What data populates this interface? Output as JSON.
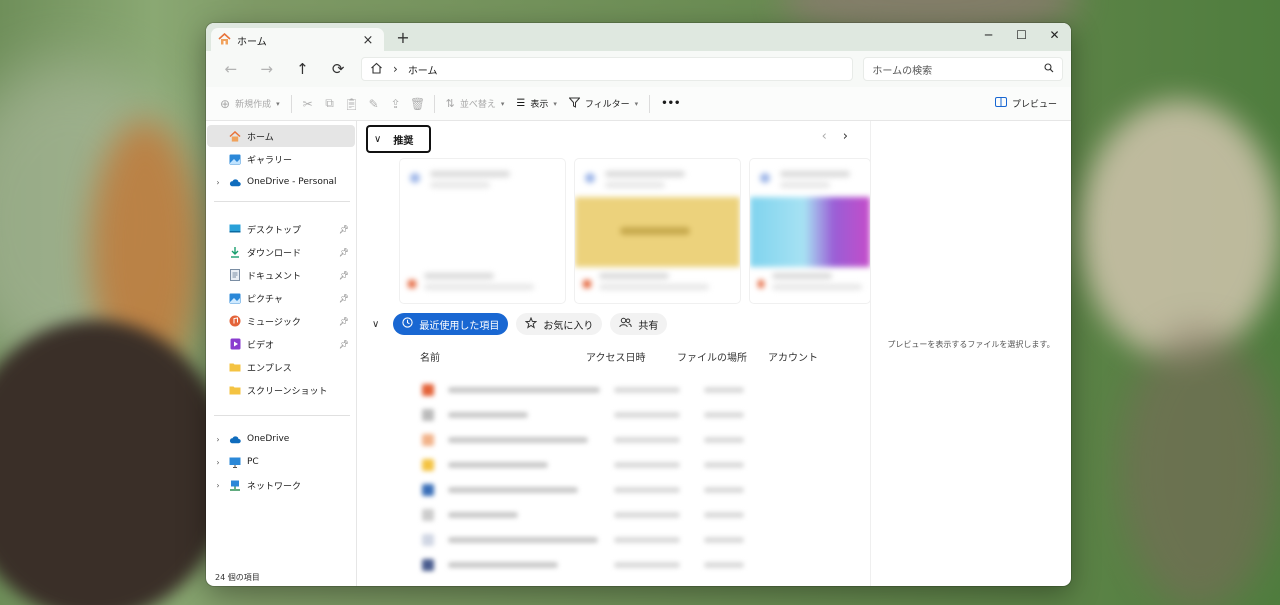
{
  "window": {
    "tab_title": "ホーム",
    "tab_close": "×",
    "new_tab": "+",
    "controls": {
      "minimize": "─",
      "maximize": "☐",
      "close": "✕"
    }
  },
  "address_bar": {
    "back": "←",
    "forward": "→",
    "up": "↑",
    "refresh": "⟳",
    "separator": "›",
    "path": "ホーム",
    "search_placeholder": "ホームの検索"
  },
  "toolbar": {
    "new_label": "新規作成",
    "sort_label": "並べ替え",
    "view_label": "表示",
    "filter_label": "フィルター",
    "more": "•••",
    "preview_label": "プレビュー"
  },
  "sidebar": {
    "items": [
      {
        "label": "ホーム",
        "icon": "home-icon",
        "selected": true
      },
      {
        "label": "ギャラリー",
        "icon": "gallery-icon"
      },
      {
        "label": "OneDrive - Personal",
        "icon": "cloud-icon",
        "expandable": true
      },
      {
        "label": "デスクトップ",
        "icon": "desktop-icon",
        "pinned": true
      },
      {
        "label": "ダウンロード",
        "icon": "download-icon",
        "pinned": true
      },
      {
        "label": "ドキュメント",
        "icon": "document-icon",
        "pinned": true
      },
      {
        "label": "ピクチャ",
        "icon": "pictures-icon",
        "pinned": true
      },
      {
        "label": "ミュージック",
        "icon": "music-icon",
        "pinned": true
      },
      {
        "label": "ビデオ",
        "icon": "video-icon",
        "pinned": true
      },
      {
        "label": "エンプレス",
        "icon": "folder-icon"
      },
      {
        "label": "スクリーンショット",
        "icon": "folder-icon"
      },
      {
        "label": "OneDrive",
        "icon": "cloud-icon",
        "expandable": true
      },
      {
        "label": "PC",
        "icon": "pc-icon",
        "expandable": true
      },
      {
        "label": "ネットワーク",
        "icon": "network-icon",
        "expandable": true
      }
    ]
  },
  "main": {
    "recommended_title": "推奨",
    "tabs": [
      {
        "label": "最近使用した項目",
        "icon": "clock-icon",
        "active": true
      },
      {
        "label": "お気に入り",
        "icon": "star-icon"
      },
      {
        "label": "共有",
        "icon": "people-icon"
      }
    ],
    "columns": [
      "名前",
      "アクセス日時",
      "ファイルの場所",
      "アカウント"
    ]
  },
  "preview": {
    "message": "プレビューを表示するファイルを選択します。"
  },
  "status": {
    "item_count": "24 個の項目"
  },
  "colors": {
    "accent": "#1967d2",
    "titlebar": "#dfe8e0",
    "selected": "#e5e5e5",
    "folder": "#f4c342",
    "onedrive": "#0f6cbd"
  }
}
